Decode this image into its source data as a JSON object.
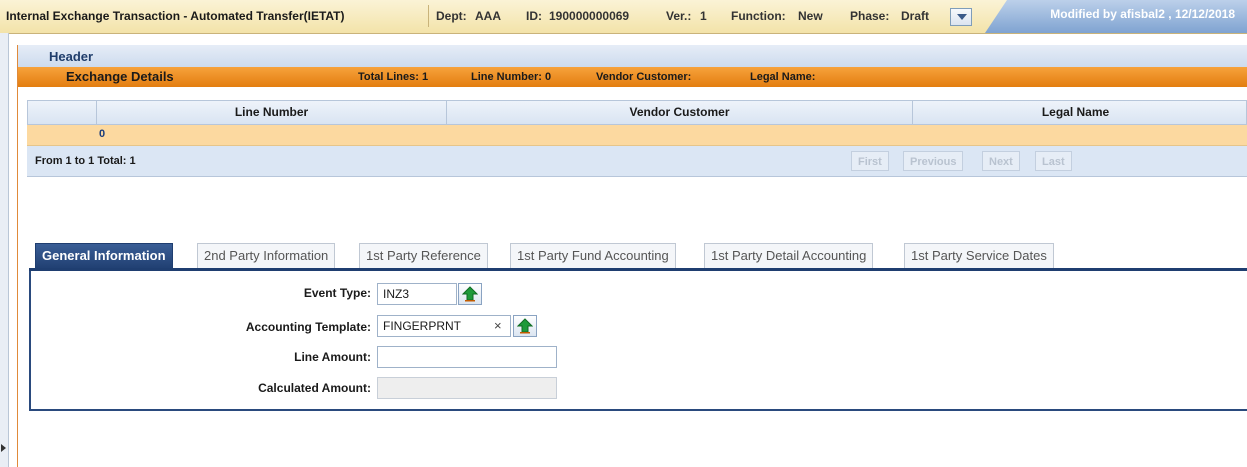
{
  "titlebar": {
    "title": "Internal Exchange Transaction - Automated Transfer(IETAT)",
    "dept_label": "Dept:",
    "dept_value": "AAA",
    "id_label": "ID:",
    "id_value": "190000000069",
    "ver_label": "Ver.:",
    "ver_value": "1",
    "function_label": "Function:",
    "function_value": "New",
    "phase_label": "Phase:",
    "phase_value": "Draft",
    "modified": "Modified by afisbal2 , 12/12/2018"
  },
  "header": {
    "title": "Header"
  },
  "exchange": {
    "title": "Exchange Details",
    "total_lines": "Total Lines: 1",
    "line_number": "Line Number: 0",
    "vendor_customer": "Vendor Customer:",
    "legal_name": "Legal Name:"
  },
  "grid": {
    "columns": [
      "Line Number",
      "Vendor Customer",
      "Legal Name"
    ],
    "rows": [
      {
        "line_number": "0",
        "vendor_customer": "",
        "legal_name": ""
      }
    ],
    "pager_text": "From 1 to 1 Total: 1",
    "buttons": {
      "first": "First",
      "previous": "Previous",
      "next": "Next",
      "last": "Last"
    }
  },
  "tabs": [
    {
      "label": "General Information",
      "active": true
    },
    {
      "label": "2nd Party Information"
    },
    {
      "label": "1st Party Reference"
    },
    {
      "label": "1st Party Fund Accounting"
    },
    {
      "label": "1st Party Detail Accounting"
    },
    {
      "label": "1st Party Service Dates"
    }
  ],
  "form": {
    "event_type_label": "Event Type:",
    "event_type_value": "INZ3",
    "accounting_template_label": "Accounting Template:",
    "accounting_template_value": "FINGERPRNT",
    "clear_glyph": "×",
    "line_amount_label": "Line Amount:",
    "line_amount_value": "",
    "calculated_amount_label": "Calculated Amount:",
    "calculated_amount_value": ""
  },
  "colors": {
    "accent_orange": "#e37d10",
    "nav_blue": "#1f3e70",
    "row_highlight": "#fcd9a0"
  },
  "icons": [
    "dropdown-arrow-icon",
    "upload-arrow-icon",
    "clear-icon",
    "collapse-arrow-icon"
  ]
}
